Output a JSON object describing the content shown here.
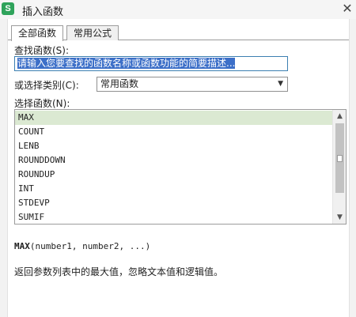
{
  "window": {
    "title": "插入函数",
    "app_icon_letter": "S",
    "close_glyph": "✕"
  },
  "tabs": [
    {
      "label": "全部函数",
      "active": true
    },
    {
      "label": "常用公式",
      "active": false
    }
  ],
  "search": {
    "label": "查找函数(S):",
    "value": "请输入您要查找的函数名称或函数功能的简要描述..."
  },
  "category": {
    "label": "或选择类别(C):",
    "selected": "常用函数"
  },
  "functions": {
    "label": "选择函数(N):",
    "items": [
      "MAX",
      "COUNT",
      "LENB",
      "ROUNDDOWN",
      "ROUNDUP",
      "INT",
      "STDEVP",
      "SUMIF"
    ],
    "selected_index": 0
  },
  "details": {
    "signature_name": "MAX",
    "signature_args": "(number1, number2, ...)",
    "description": "返回参数列表中的最大值，忽略文本值和逻辑值。"
  },
  "colors": {
    "selected_row": "#dbe9d2",
    "input_selection": "#3c6fc8",
    "app_icon": "#2fa35b"
  },
  "icons": {
    "app": "wps-spreadsheet-icon",
    "close": "close-icon",
    "dropdown": "chevron-down-icon",
    "scroll_up": "scroll-up-arrow-icon",
    "scroll_down": "scroll-down-arrow-icon"
  }
}
